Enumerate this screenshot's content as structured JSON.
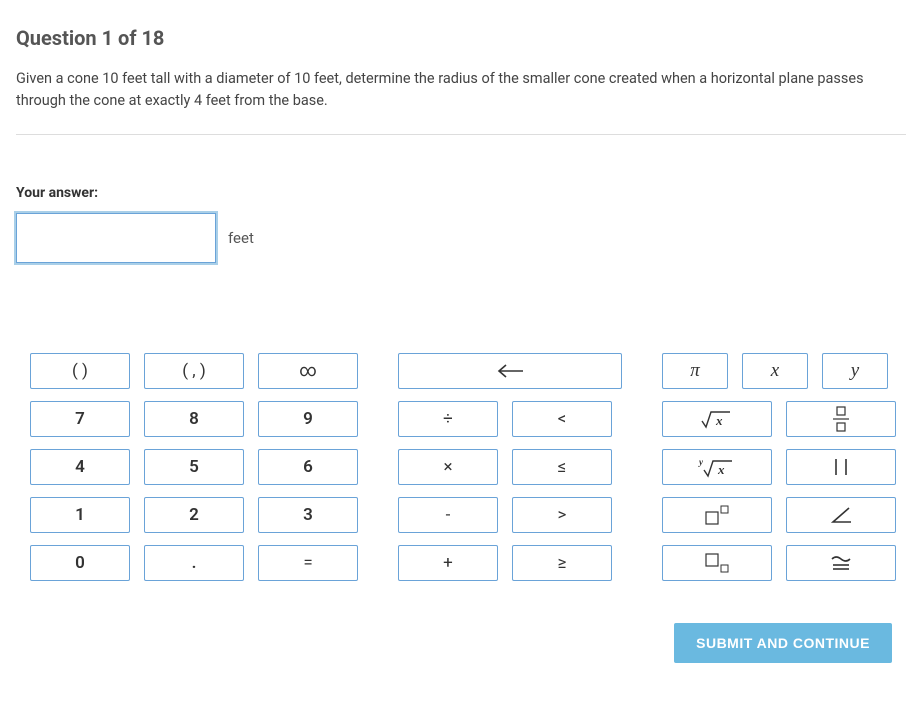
{
  "question": {
    "title": "Question 1 of 18",
    "text": "Given a cone 10 feet tall with a diameter of 10 feet, determine the radius of the smaller cone created when a horizontal plane passes through the cone at exactly 4 feet from the base."
  },
  "answer": {
    "label": "Your answer:",
    "value": "",
    "unit": "feet"
  },
  "keypad": {
    "group1": {
      "row0": [
        "( )",
        "( , )",
        "∞"
      ],
      "row1": [
        "7",
        "8",
        "9"
      ],
      "row2": [
        "4",
        "5",
        "6"
      ],
      "row3": [
        "1",
        "2",
        "3"
      ],
      "row4": [
        "0",
        ".",
        "="
      ]
    },
    "group2": {
      "backspace": "←",
      "row1": [
        "÷",
        "<"
      ],
      "row2": [
        "×",
        "≤"
      ],
      "row3": [
        "-",
        ">"
      ],
      "row4": [
        "+",
        "≥"
      ]
    },
    "group3": {
      "row0": [
        "π",
        "x",
        "y"
      ],
      "row1": [
        "root",
        "fraction"
      ],
      "row2": [
        "nroot",
        "abs"
      ],
      "row3": [
        "super",
        "angle"
      ],
      "row4": [
        "sub",
        "congruent"
      ]
    }
  },
  "footer": {
    "submit": "SUBMIT AND CONTINUE"
  }
}
